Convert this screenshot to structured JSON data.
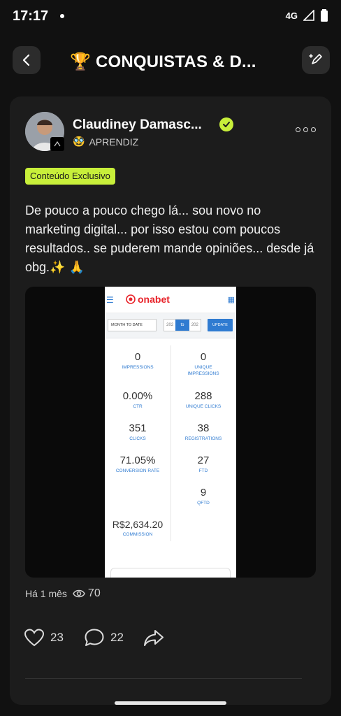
{
  "status_bar": {
    "time": "17:17",
    "network": "4G"
  },
  "header": {
    "title": "🏆 CONQUISTAS & D..."
  },
  "post": {
    "author": {
      "name": "Claudiney Damasc...",
      "level": "APRENDIZ",
      "level_emoji": "🥸"
    },
    "badge": "Conteúdo Exclusivo",
    "text": "De pouco a pouco chego lá... sou novo no marketing digital... por isso estou com poucos resultados.. se puderem mande opiniões... desde já obg.✨ 🙏",
    "time_ago": "Há 1 mês",
    "views": "70",
    "likes": "23",
    "comments": "22"
  },
  "screenshot": {
    "logo": "onabet",
    "filter": "MONTH TO DATE",
    "date_from": "202",
    "date_to_label": "to",
    "date_to": "202",
    "update_label": "UPDATE",
    "stats": [
      {
        "value": "0",
        "label": "IMPRESSIONS"
      },
      {
        "value": "0",
        "label": "UNIQUE IMPRESSIONS"
      },
      {
        "value": "0.00%",
        "label": "CTR"
      },
      {
        "value": "288",
        "label": "UNIQUE CLICKS"
      },
      {
        "value": "351",
        "label": "CLICKS"
      },
      {
        "value": "38",
        "label": "REGISTRATIONS"
      },
      {
        "value": "71.05%",
        "label": "CONVERSION RATE"
      },
      {
        "value": "27",
        "label": "FTD"
      },
      {
        "value": "9",
        "label": "QFTD"
      },
      {
        "value": "R$2,634.20",
        "label": "COMMISSION"
      }
    ]
  },
  "colors": {
    "accent": "#c8ef3a",
    "background": "#111111",
    "card": "#1c1c1c",
    "onabet_red": "#e8242b",
    "onabet_blue": "#2f7bd1"
  }
}
